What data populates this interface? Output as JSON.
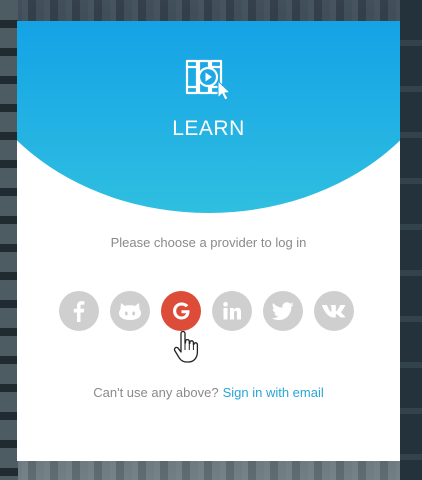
{
  "app": {
    "title": "LEARN",
    "logo_icon": "video-library-cursor-icon"
  },
  "prompt": "Please choose a provider to log in",
  "providers": [
    {
      "id": "facebook",
      "icon": "facebook-icon",
      "active": false
    },
    {
      "id": "github",
      "icon": "github-icon",
      "active": false
    },
    {
      "id": "google",
      "icon": "google-icon",
      "active": true
    },
    {
      "id": "linkedin",
      "icon": "linkedin-icon",
      "active": false
    },
    {
      "id": "twitter",
      "icon": "twitter-icon",
      "active": false
    },
    {
      "id": "vk",
      "icon": "vk-icon",
      "active": false
    }
  ],
  "footer": {
    "text": "Can't use any above?",
    "link": "Sign in with email"
  },
  "colors": {
    "header_top": "#0d9ae8",
    "header_bottom": "#2fbfe0",
    "provider_inactive": "#cfcfcf",
    "google_active": "#dd4b39",
    "link": "#2aa5d8"
  }
}
